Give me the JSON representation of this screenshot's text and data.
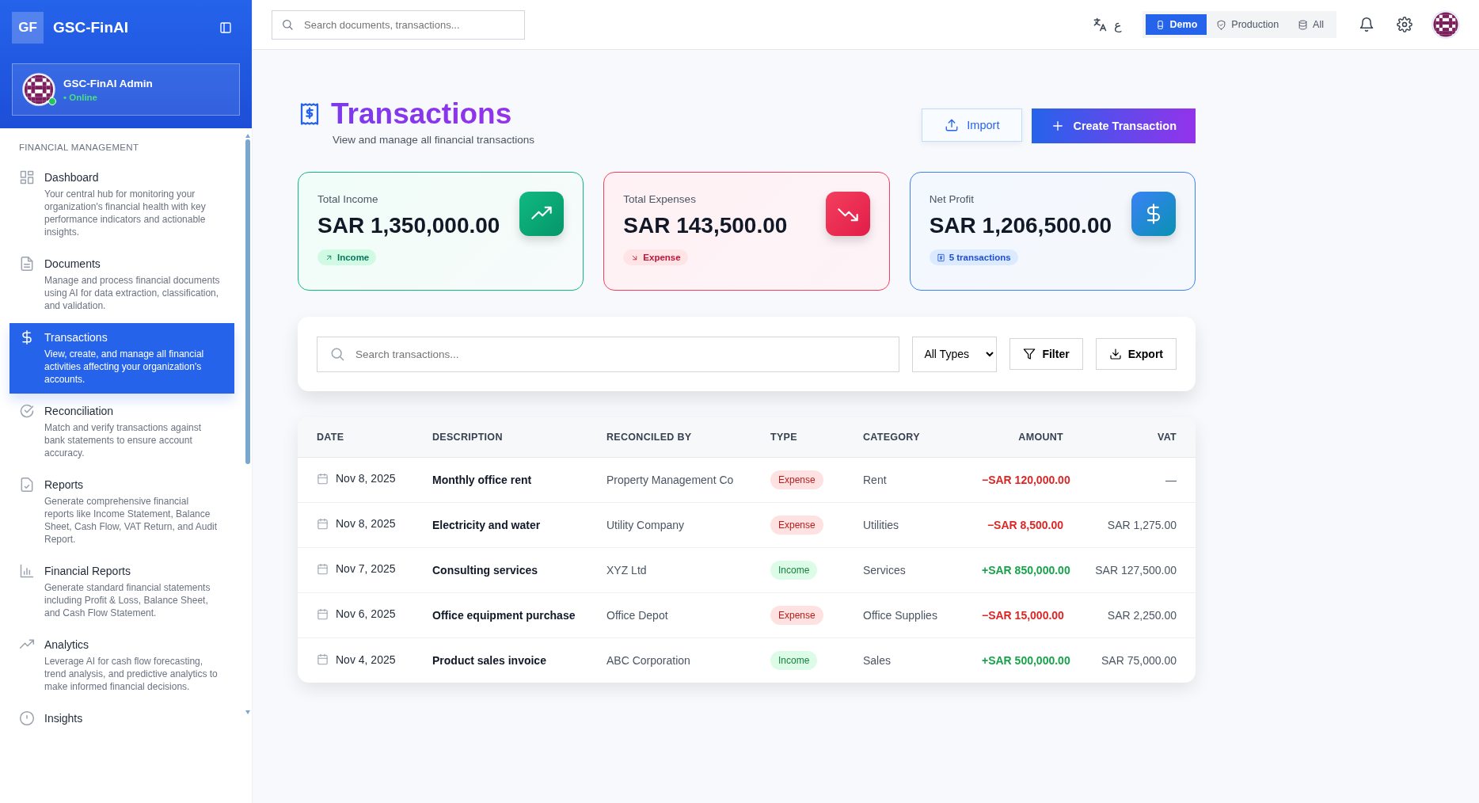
{
  "sidebar": {
    "logo": "GF",
    "app_name": "GSC-FinAI",
    "user": {
      "name": "GSC-FinAI Admin",
      "status": "• Online"
    },
    "section_title": "FINANCIAL MANAGEMENT",
    "items": [
      {
        "label": "Dashboard",
        "description": "Your central hub for monitoring your organization's financial health with key performance indicators and actionable insights.",
        "selected": false
      },
      {
        "label": "Documents",
        "description": "Manage and process financial documents using AI for data extraction, classification, and validation.",
        "selected": false
      },
      {
        "label": "Transactions",
        "description": "View, create, and manage all financial activities affecting your organization's accounts.",
        "selected": true
      },
      {
        "label": "Reconciliation",
        "description": "Match and verify transactions against bank statements to ensure account accuracy.",
        "selected": false
      },
      {
        "label": "Reports",
        "description": "Generate comprehensive financial reports like Income Statement, Balance Sheet, Cash Flow, VAT Return, and Audit Report.",
        "selected": false
      },
      {
        "label": "Financial Reports",
        "description": "Generate standard financial statements including Profit & Loss, Balance Sheet, and Cash Flow Statement.",
        "selected": false
      },
      {
        "label": "Analytics",
        "description": "Leverage AI for cash flow forecasting, trend analysis, and predictive analytics to make informed financial decisions.",
        "selected": false
      },
      {
        "label": "Insights",
        "selected": false
      }
    ]
  },
  "topbar": {
    "search": {
      "placeholder": "Search documents, transactions..."
    },
    "language": "ع",
    "modes": [
      {
        "label": "Demo",
        "selected": true
      },
      {
        "label": "Production",
        "selected": false
      },
      {
        "label": "All",
        "selected": false
      }
    ]
  },
  "page": {
    "title": "Transactions",
    "subtitle": "View and manage all financial transactions",
    "buttons": [
      {
        "label": "Import",
        "kind": "secondary"
      },
      {
        "label": "Create Transaction",
        "kind": "primary"
      }
    ]
  },
  "stats": [
    {
      "kind": "income",
      "label": "Total Income",
      "value": "SAR 1,350,000.00",
      "tag": "Income"
    },
    {
      "kind": "expense",
      "label": "Total Expenses",
      "value": "SAR 143,500.00",
      "tag": "Expense"
    },
    {
      "kind": "profit",
      "label": "Net Profit",
      "value": "SAR 1,206,500.00",
      "tag": "5 transactions"
    }
  ],
  "toolbar": {
    "search": {
      "placeholder": "Search transactions..."
    },
    "type_select": "All Types",
    "buttons": [
      "Filter",
      "Export"
    ]
  },
  "table": {
    "columns": [
      "DATE",
      "DESCRIPTION",
      "RECONCILED BY",
      "TYPE",
      "CATEGORY",
      "AMOUNT",
      "VAT"
    ],
    "rows": [
      {
        "date": "Nov 8, 2025",
        "description": "Monthly office rent",
        "reconciled_by": "Property Management Co",
        "kind": "expense",
        "type": "Expense",
        "category": "Rent",
        "amount": "−SAR 120,000.00",
        "vat": "—"
      },
      {
        "date": "Nov 8, 2025",
        "description": "Electricity and water",
        "reconciled_by": "Utility Company",
        "kind": "expense",
        "type": "Expense",
        "category": "Utilities",
        "amount": "−SAR 8,500.00",
        "vat": "SAR 1,275.00"
      },
      {
        "date": "Nov 7, 2025",
        "description": "Consulting services",
        "reconciled_by": "XYZ Ltd",
        "kind": "income",
        "type": "Income",
        "category": "Services",
        "amount": "+SAR 850,000.00",
        "vat": "SAR 127,500.00"
      },
      {
        "date": "Nov 6, 2025",
        "description": "Office equipment purchase",
        "reconciled_by": "Office Depot",
        "kind": "expense",
        "type": "Expense",
        "category": "Office Supplies",
        "amount": "−SAR 15,000.00",
        "vat": "SAR 2,250.00"
      },
      {
        "date": "Nov 4, 2025",
        "description": "Product sales invoice",
        "reconciled_by": "ABC Corporation",
        "kind": "income",
        "type": "Income",
        "category": "Sales",
        "amount": "+SAR 500,000.00",
        "vat": "SAR 75,000.00"
      }
    ]
  }
}
